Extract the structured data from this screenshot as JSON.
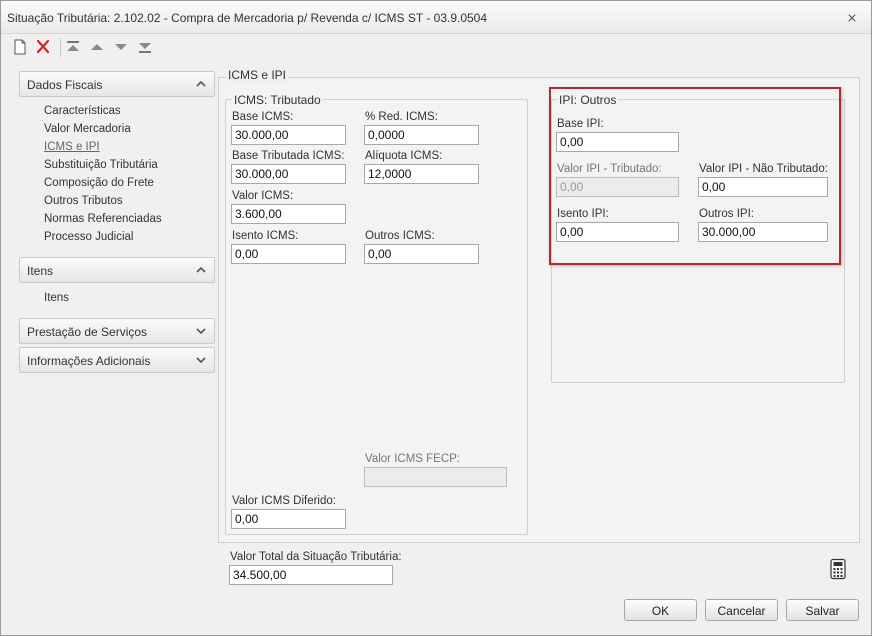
{
  "window": {
    "title": "Situação Tributária: 2.102.02 - Compra de Mercadoria p/ Revenda c/ ICMS ST - 03.9.0504",
    "close_glyph": "⨯"
  },
  "toolbar": {
    "icons": [
      "new-document-icon",
      "delete-icon",
      "move-first-icon",
      "move-up-icon",
      "move-down-icon",
      "move-last-icon"
    ]
  },
  "sidebar": {
    "sections": [
      {
        "label": "Dados Fiscais",
        "expanded": true,
        "items": [
          {
            "label": "Características"
          },
          {
            "label": "Valor Mercadoria"
          },
          {
            "label": "ICMS e IPI",
            "active": true
          },
          {
            "label": "Substituição Tributária"
          },
          {
            "label": "Composição do Frete"
          },
          {
            "label": "Outros Tributos"
          },
          {
            "label": "Normas Referenciadas"
          },
          {
            "label": "Processo Judicial"
          }
        ]
      },
      {
        "label": "Itens",
        "expanded": true,
        "items": [
          {
            "label": "Itens"
          }
        ]
      },
      {
        "label": "Prestação de Serviços",
        "expanded": false
      },
      {
        "label": "Informações Adicionais",
        "expanded": false
      }
    ]
  },
  "main": {
    "title": "ICMS e IPI",
    "icms": {
      "title": "ICMS: Tributado",
      "base_icms": {
        "label": "Base ICMS:",
        "value": "30.000,00"
      },
      "red_icms": {
        "label": "% Red. ICMS:",
        "value": "0,0000"
      },
      "base_tributada": {
        "label": "Base Tributada ICMS:",
        "value": "30.000,00"
      },
      "aliquota": {
        "label": "Alíquota ICMS:",
        "value": "12,0000"
      },
      "valor_icms": {
        "label": "Valor ICMS:",
        "value": "3.600,00"
      },
      "isento": {
        "label": "Isento ICMS:",
        "value": "0,00"
      },
      "outros": {
        "label": "Outros ICMS:",
        "value": "0,00"
      },
      "fecp": {
        "label": "Valor ICMS FECP:",
        "value": ""
      },
      "diferido": {
        "label": "Valor ICMS Diferido:",
        "value": "0,00"
      }
    },
    "ipi": {
      "title": "IPI: Outros",
      "base_ipi": {
        "label": "Base IPI:",
        "value": "0,00"
      },
      "valor_tributado": {
        "label": "Valor IPI - Tributado:",
        "value": "0,00"
      },
      "valor_nao_tributado": {
        "label": "Valor IPI - Não Tributado:",
        "value": "0,00"
      },
      "isento": {
        "label": "Isento IPI:",
        "value": "0,00"
      },
      "outros": {
        "label": "Outros IPI:",
        "value": "30.000,00"
      }
    }
  },
  "footer": {
    "total_label": "Valor Total da Situação Tributária:",
    "total_value": "34.500,00",
    "ok_label": "OK",
    "cancel_label": "Cancelar",
    "save_label": "Salvar"
  },
  "colors": {
    "highlight_border": "#b02a30",
    "delete_icon": "#d42020"
  }
}
